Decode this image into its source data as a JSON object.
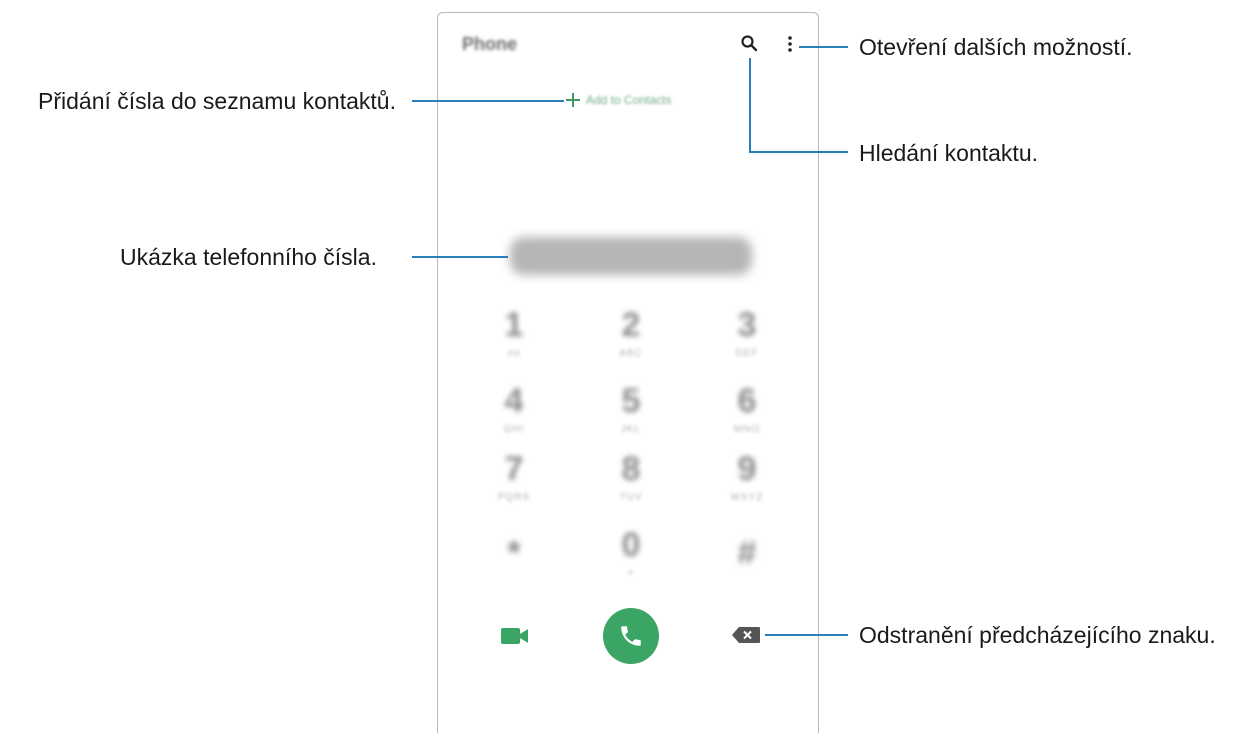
{
  "phone": {
    "app_title": "Phone",
    "add_to_contacts_label": "Add to Contacts",
    "keypad": [
      {
        "digit": "1",
        "letters": "oo"
      },
      {
        "digit": "2",
        "letters": "ABC"
      },
      {
        "digit": "3",
        "letters": "DEF"
      },
      {
        "digit": "4",
        "letters": "GHI"
      },
      {
        "digit": "5",
        "letters": "JKL"
      },
      {
        "digit": "6",
        "letters": "MNO"
      },
      {
        "digit": "7",
        "letters": "PQRS"
      },
      {
        "digit": "8",
        "letters": "TUV"
      },
      {
        "digit": "9",
        "letters": "WXYZ"
      },
      {
        "digit": "*",
        "letters": ""
      },
      {
        "digit": "0",
        "letters": "+"
      },
      {
        "digit": "#",
        "letters": ""
      }
    ],
    "icons": {
      "search": "search-icon",
      "more": "more-options-icon",
      "add": "plus-icon",
      "video": "video-call-icon",
      "call": "phone-icon",
      "backspace": "backspace-icon"
    },
    "colors": {
      "accent_green": "#3aa565",
      "callout_line": "#2b7dbb"
    }
  },
  "callouts": {
    "more_options": "Otevření dalších možností.",
    "add_contact": "Přidání čísla do seznamu kontaktů.",
    "search_contact": "Hledání kontaktu.",
    "number_preview": "Ukázka telefonního čísla.",
    "delete_char": "Odstranění předcházejícího znaku."
  }
}
